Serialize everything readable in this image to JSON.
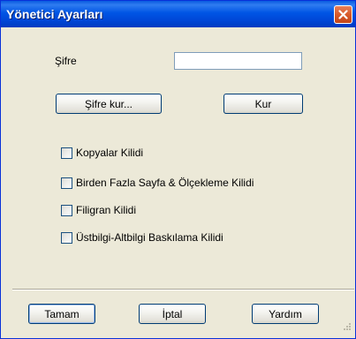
{
  "window": {
    "title": "Yönetici Ayarları"
  },
  "password": {
    "label": "Şifre",
    "value": "",
    "placeholder": ""
  },
  "buttons": {
    "set_password": "Şifre kur...",
    "set": "Kur",
    "ok": "Tamam",
    "cancel": "İptal",
    "help": "Yardım"
  },
  "locks": [
    {
      "label": "Kopyalar Kilidi",
      "checked": false
    },
    {
      "label": "Birden Fazla Sayfa & Ölçekleme Kilidi",
      "checked": false
    },
    {
      "label": "Filigran Kilidi",
      "checked": false
    },
    {
      "label": "Üstbilgi-Altbilgi Baskılama Kilidi",
      "checked": false
    }
  ],
  "icons": {
    "close": "close-icon",
    "resize": "resize-grip-icon"
  },
  "colors": {
    "titlebar": "#0055e5",
    "close_button": "#d85a2a",
    "dialog_background": "#ece9d8",
    "button_border": "#003c74"
  }
}
